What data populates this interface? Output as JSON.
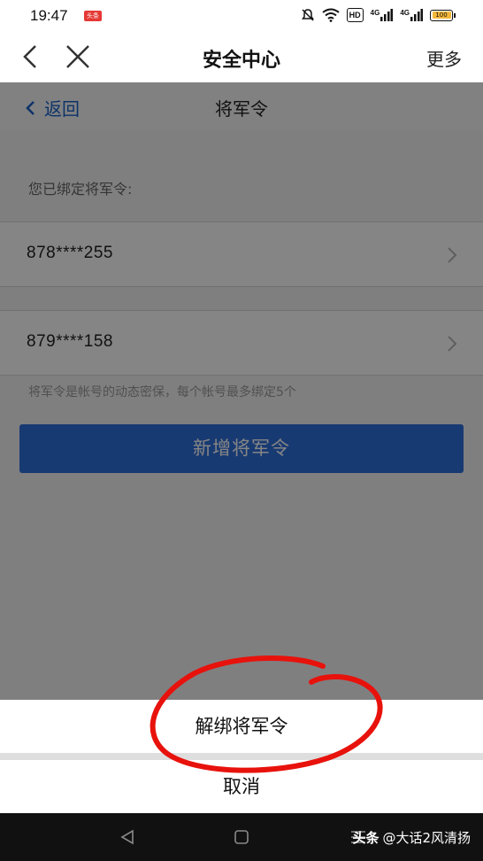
{
  "status_bar": {
    "time": "19:47",
    "app_badge": "头条",
    "network_1": "4G",
    "network_2": "4G",
    "hd_label": "HD",
    "battery": "100",
    "battery_color": "#f4b73a"
  },
  "app_header": {
    "title": "安全中心",
    "more_label": "更多"
  },
  "web_page": {
    "back_label": "返回",
    "title": "将军令",
    "bound_label": "您已绑定将军令:",
    "tokens": [
      {
        "value": "878****255"
      },
      {
        "value": "879****158"
      }
    ],
    "hint": "将军令是帐号的动态密保，每个帐号最多绑定5个",
    "add_button": "新增将军令"
  },
  "action_sheet": {
    "unbind_label": "解绑将军令",
    "cancel_label": "取消"
  },
  "watermark": {
    "prefix": "头条",
    "text": "@大话2风清扬"
  },
  "colors": {
    "accent": "#2f6fdb",
    "link": "#1a63c8",
    "annotation": "#e8120c"
  }
}
